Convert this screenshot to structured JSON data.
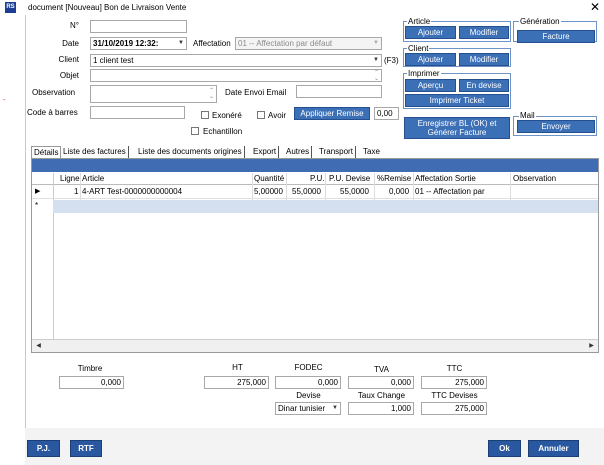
{
  "window": {
    "title": "document [Nouveau] Bon de Livraison Vente",
    "close": "✕",
    "app_icon": "RS"
  },
  "form": {
    "no_label": "N°",
    "no_value": "",
    "date_label": "Date",
    "date_value": "31/10/2019 12:32:",
    "affectation_label": "Affectation",
    "affectation_value": "01 -- Affectation par défaut",
    "client_label": "Client",
    "client_value": "1 client test",
    "client_hint": "(F3)",
    "objet_label": "Objet",
    "objet_value": "",
    "observation_label": "Observation",
    "observation_value": "",
    "date_envoi_label": "Date Envoi Email",
    "date_envoi_value": "",
    "code_barres_label": "Code à barres",
    "code_barres_value": "",
    "exonere_label": "Exonéré",
    "avoir_label": "Avoir",
    "echantillon_label": "Echantillon",
    "appliquer_remise": "Appliquer Remise",
    "remise_value": "0,00"
  },
  "groups": {
    "article": {
      "title": "Article",
      "ajouter": "Ajouter",
      "modifier": "Modifier"
    },
    "generation": {
      "title": "Génération",
      "facture": "Facture"
    },
    "client": {
      "title": "Client",
      "ajouter": "Ajouter",
      "modifier": "Modifier"
    },
    "imprimer": {
      "title": "Imprimer",
      "apercu": "Aperçu",
      "en_devise": "En devise",
      "imprimer_ticket": "Imprimer Ticket"
    },
    "mail": {
      "title": "Mail",
      "envoyer": "Envoyer"
    },
    "enregistrer_line1": "Enregistrer BL (OK) et",
    "enregistrer_line2": "Générer Facture"
  },
  "tabs": [
    "Détails",
    "Liste des factures",
    "Liste des documents origines",
    "Export",
    "Autres",
    "Transport",
    "Taxe"
  ],
  "grid": {
    "headers": [
      "Ligne",
      "Article",
      "Quantité",
      "P.U.",
      "P.U. Devise",
      "%Remise",
      "Affectation Sortie",
      "Observation"
    ],
    "rows": [
      {
        "marker": "▶",
        "ligne": "1",
        "article": "4-ART Test-0000000000004",
        "quantite": "5,00000",
        "pu": "55,0000",
        "pu_devise": "55,0000",
        "remise": "0,000",
        "affectation": "01 -- Affectation par",
        "observation": ""
      }
    ],
    "new_row_marker": "*"
  },
  "totals": {
    "timbre_label": "Timbre",
    "timbre_value": "0,000",
    "ht_label": "HT",
    "ht_value": "275,000",
    "fodec_label": "FODEC",
    "fodec_value": "0,000",
    "tva_label": "TVA",
    "tva_value": "0,000",
    "ttc_label": "TTC",
    "ttc_value": "275,000",
    "devise_label": "Devise",
    "devise_value": "Dinar tunisier",
    "taux_label": "Taux Change",
    "taux_value": "1,000",
    "ttc_devises_label": "TTC Devises",
    "ttc_devises_value": "275,000"
  },
  "footer": {
    "pj": "P.J.",
    "rtf": "RTF",
    "ok": "Ok",
    "annuler": "Annuler"
  },
  "side_mark": "-"
}
